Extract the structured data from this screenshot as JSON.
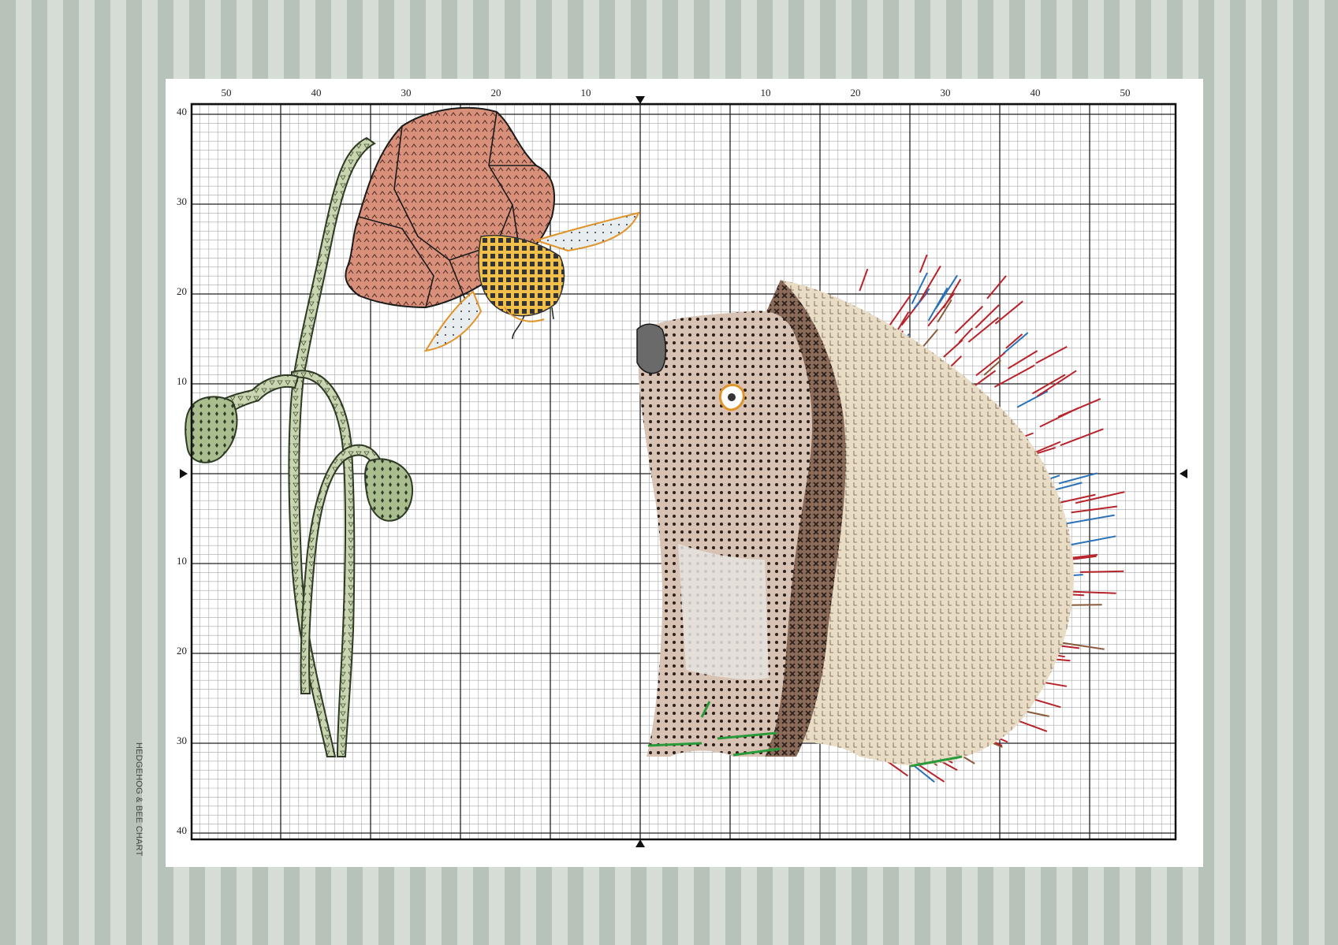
{
  "chart": {
    "side_title": "HEDGEHOG & BEE CHART",
    "top_labels_left": [
      "50",
      "40",
      "30",
      "20",
      "10"
    ],
    "top_labels_right": [
      "10",
      "20",
      "30",
      "40",
      "50"
    ],
    "left_labels_top": [
      "40",
      "30",
      "20",
      "10"
    ],
    "left_labels_bottom": [
      "10",
      "20",
      "30",
      "40"
    ]
  },
  "colors": {
    "paper": "#ffffff",
    "stripe_dark": "#b7c3b8",
    "stripe_light": "#d6ddd6",
    "grid_fine": "#9a9a9a",
    "grid_major": "#222222",
    "flower_pink": "#d9907a",
    "flower_dark": "#4a2a22",
    "stem_green": "#c9d4b0",
    "stem_dark": "#2e3a24",
    "leaf_green": "#a9bd8f",
    "bee_yellow": "#f0c04a",
    "bee_outline": "#e0942a",
    "wing_grey": "#e8eef0",
    "hedgehog_face": "#d7c2b4",
    "hedgehog_brown": "#8a6a58",
    "hedgehog_dark": "#2a1e1a",
    "hedgehog_cream": "#e9dcc5",
    "nose_grey": "#6a6a6a",
    "spine_red": "#b8222a",
    "spine_blue": "#2a72b8",
    "spine_brown": "#8a5a3a",
    "grass_green": "#2a9a3a"
  }
}
